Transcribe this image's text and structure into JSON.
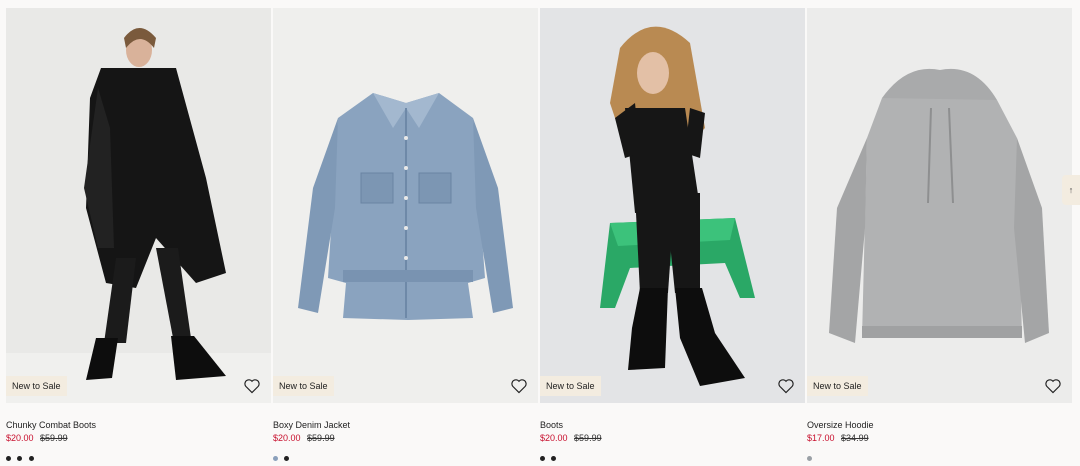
{
  "products": [
    {
      "name": "Chunky Combat Boots",
      "sale_price": "$20.00",
      "orig_price": "$59.99",
      "badge": "New to Sale",
      "bg": "#e9e9e7",
      "swatches": [
        "#222222",
        "#222222",
        "#222222"
      ]
    },
    {
      "name": "Boxy Denim Jacket",
      "sale_price": "$20.00",
      "orig_price": "$59.99",
      "badge": "New to Sale",
      "bg": "#efefed",
      "swatches": [
        "#8aa0bb",
        "#222222"
      ]
    },
    {
      "name": "Boots",
      "sale_price": "$20.00",
      "orig_price": "$59.99",
      "badge": "New to Sale",
      "bg": "#e3e4e6",
      "swatches": [
        "#222222",
        "#222222"
      ]
    },
    {
      "name": "Oversize Hoodie",
      "sale_price": "$17.00",
      "orig_price": "$34.99",
      "badge": "New to Sale",
      "bg": "#ececeb",
      "swatches": [
        "#9aa0a6"
      ]
    }
  ],
  "scroll_top_icon": "arrow-up-icon",
  "favorite_icon": "heart-icon"
}
